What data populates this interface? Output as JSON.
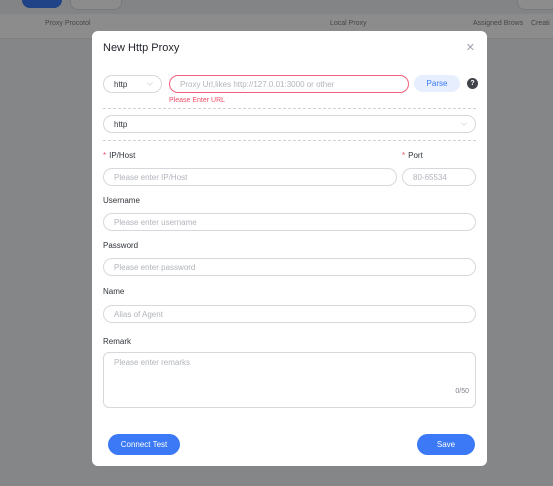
{
  "background": {
    "table_headers": {
      "proxy_protocol": "Proxy Procotol",
      "local_proxy": "Local Proxy",
      "assigned_brows": "Assigned Brows",
      "created": "Creati"
    }
  },
  "dialog": {
    "title": "New Http Proxy",
    "close_icon": "close-icon",
    "protocol_select": {
      "value": "http"
    },
    "url_input": {
      "placeholder": "Proxy Url,likes http://127.0.01:3000 or other",
      "error": "Please Enter URL"
    },
    "parse_button": "Parse",
    "help_icon": "?",
    "type_select": {
      "value": "http"
    },
    "ip_host": {
      "label": "IP/Host",
      "placeholder": "Please enter IP/Host"
    },
    "port": {
      "label": "Port",
      "placeholder": "80-65534"
    },
    "username": {
      "label": "Username",
      "placeholder": "Please enter username"
    },
    "password": {
      "label": "Password",
      "placeholder": "Please enter password"
    },
    "name": {
      "label": "Name",
      "placeholder": "Alias of Agent"
    },
    "remark": {
      "label": "Remark",
      "placeholder": "Please enter remarks",
      "counter": "0/50"
    },
    "connect_test_button": "Connect Test",
    "save_button": "Save"
  },
  "colors": {
    "primary": "#3b79f6",
    "error": "#f04d6a"
  }
}
